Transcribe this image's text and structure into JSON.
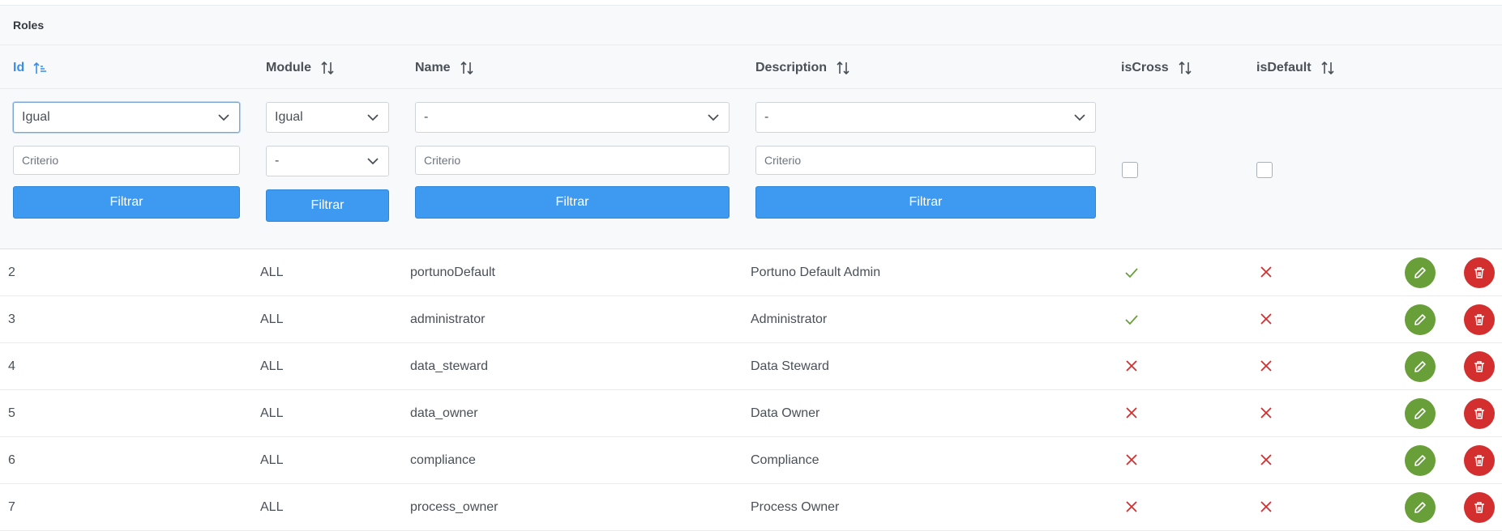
{
  "caption": {
    "title": "Roles"
  },
  "columns": [
    {
      "key": "id",
      "label": "Id",
      "active": true
    },
    {
      "key": "module",
      "label": "Module",
      "active": false
    },
    {
      "key": "name",
      "label": "Name",
      "active": false
    },
    {
      "key": "description",
      "label": "Description",
      "active": false
    },
    {
      "key": "isCross",
      "label": "isCross",
      "active": false
    },
    {
      "key": "isDefault",
      "label": "isDefault",
      "active": false
    }
  ],
  "filters": {
    "id": {
      "operator": "Igual",
      "placeholder": "Criterio",
      "button": "Filtrar"
    },
    "module": {
      "operator": "Igual",
      "value": "-",
      "button": "Filtrar"
    },
    "name": {
      "operator": "-",
      "placeholder": "Criterio",
      "button": "Filtrar"
    },
    "description": {
      "operator": "-",
      "placeholder": "Criterio",
      "button": "Filtrar"
    }
  },
  "rows": [
    {
      "id": "2",
      "module": "ALL",
      "name": "portunoDefault",
      "description": "Portuno Default Admin",
      "isCross": true,
      "isDefault": false
    },
    {
      "id": "3",
      "module": "ALL",
      "name": "administrator",
      "description": "Administrator",
      "isCross": true,
      "isDefault": false
    },
    {
      "id": "4",
      "module": "ALL",
      "name": "data_steward",
      "description": "Data Steward",
      "isCross": false,
      "isDefault": false
    },
    {
      "id": "5",
      "module": "ALL",
      "name": "data_owner",
      "description": "Data Owner",
      "isCross": false,
      "isDefault": false
    },
    {
      "id": "6",
      "module": "ALL",
      "name": "compliance",
      "description": "Compliance",
      "isCross": false,
      "isDefault": false
    },
    {
      "id": "7",
      "module": "ALL",
      "name": "process_owner",
      "description": "Process Owner",
      "isCross": false,
      "isDefault": false
    }
  ],
  "colors": {
    "accent": "#3d9af0",
    "check": "#689f38",
    "cross": "#d32f2f",
    "edit": "#689f38",
    "delete": "#d32f2f"
  },
  "icons": {
    "sort": "sort-alt-icon",
    "sortActive": "sort-amount-up-icon",
    "edit": "pencil-icon",
    "delete": "trash-icon",
    "true": "check-icon",
    "false": "times-icon",
    "dropdown": "chevron-down-icon"
  }
}
